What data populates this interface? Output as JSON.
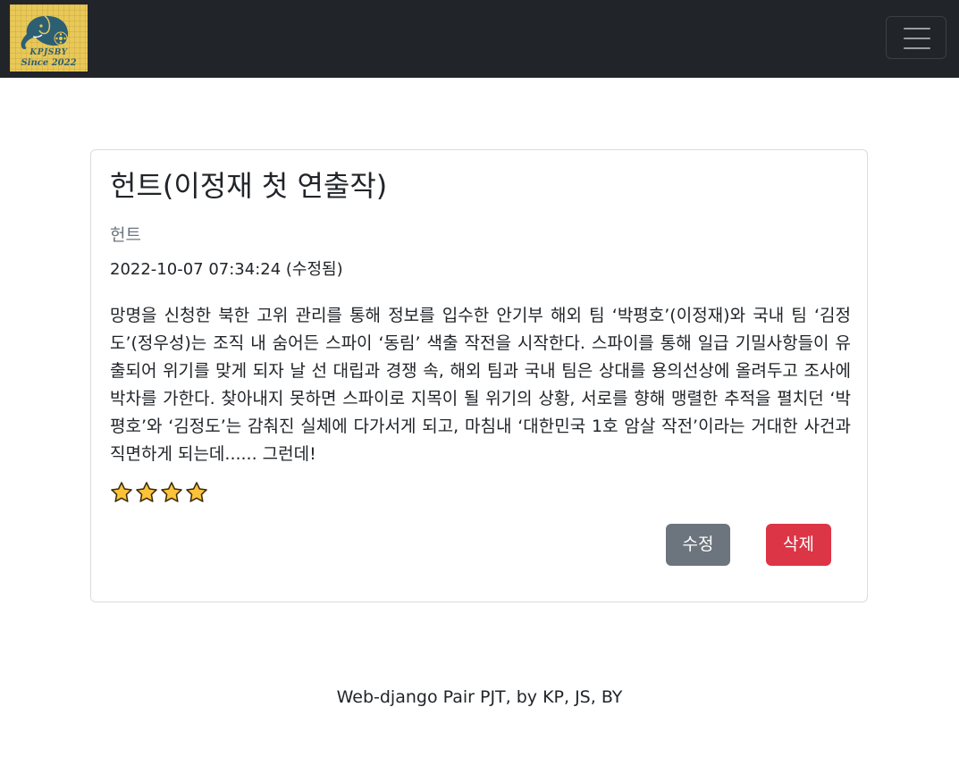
{
  "header": {
    "logo": {
      "name_text": "KPJSBY",
      "since_text": "Since 2022",
      "icon": "elephant-logo-icon"
    },
    "menu_toggle_icon": "hamburger-menu-icon"
  },
  "card": {
    "title": "헌트(이정재 첫 연출작)",
    "movie": "헌트",
    "date": "2022-10-07 07:34:24 (수정됨)",
    "content": "망명을 신청한 북한 고위 관리를 통해 정보를 입수한 안기부 해외 팀 ‘박평호’(이정재)와 국내 팀 ‘김정도’(정우성)는 조직 내 숨어든 스파이 ‘동림’ 색출 작전을 시작한다. 스파이를 통해 일급 기밀사항들이 유출되어 위기를 맞게 되자 날 선 대립과 경쟁 속, 해외 팀과 국내 팀은 상대를 용의선상에 올려두고 조사에 박차를 가한다. 찾아내지 못하면 스파이로 지목이 될 위기의 상황, 서로를 향해 맹렬한 추적을 펼치던 ‘박평호’와 ‘김정도’는 감춰진 실체에 다가서게 되고, 마침내 ‘대한민국 1호 암살 작전’이라는 거대한 사건과 직면하게 되는데...... 그런데!",
    "rating": 4,
    "star_icon": "star-icon",
    "edit_label": "수정",
    "delete_label": "삭제"
  },
  "footer": {
    "text": "Web-django Pair PJT, by KP, JS, BY"
  },
  "colors": {
    "navbar_bg": "#212529",
    "edit_button": "#6c757d",
    "delete_button": "#dc3545",
    "star_fill": "#fcc33a"
  }
}
